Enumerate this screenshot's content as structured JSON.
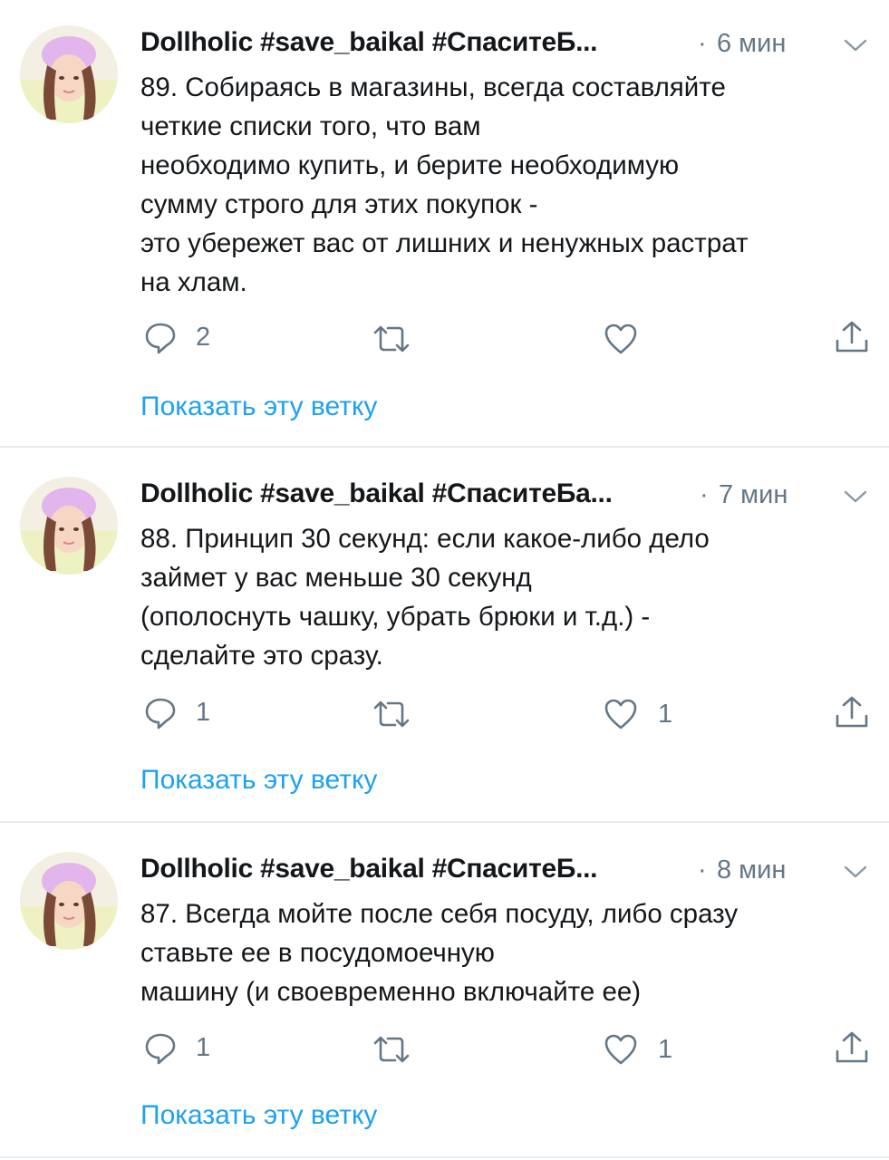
{
  "colors": {
    "link": "#1da1f2",
    "secondary": "#657786",
    "text": "#14171a",
    "divider": "#e6ecf0"
  },
  "tweets": [
    {
      "author": "Dollholic #save_baikal #СпаситеБ...",
      "separator": "·",
      "time": "6 мин",
      "lines": [
        "89. Собираясь в магазины, всегда составляйте",
        "четкие списки того, что вам",
        "необходимо купить, и берите необходимую",
        "сумму строго для этих покупок -",
        "это убережет вас от лишних и ненужных растрат",
        "на хлам."
      ],
      "reply_count": "2",
      "retweet_count": "",
      "like_count": "",
      "thread_link": "Показать эту ветку"
    },
    {
      "author": "Dollholic #save_baikal #СпаситеБа...",
      "separator": "·",
      "time": "7 мин",
      "lines": [
        "88. Принцип 30 секунд: если какое-либо дело",
        "займет у вас меньше 30 секунд",
        "(ополоснуть чашку, убрать брюки и т.д.) -",
        "сделайте это сразу."
      ],
      "reply_count": "1",
      "retweet_count": "",
      "like_count": "1",
      "thread_link": "Показать эту ветку"
    },
    {
      "author": "Dollholic #save_baikal #СпаситеБ...",
      "separator": "·",
      "time": "8 мин",
      "lines": [
        "87. Всегда мойте после себя посуду, либо сразу",
        "ставьте ее в посудомоечную",
        "машину (и своевременно включайте ее)"
      ],
      "reply_count": "1",
      "retweet_count": "",
      "like_count": "1",
      "thread_link": "Показать эту ветку"
    }
  ],
  "icons": {
    "avatar": "user-avatar-photo",
    "reply": "reply-bubble-icon",
    "retweet": "retweet-icon",
    "like": "heart-icon",
    "share": "share-upload-icon",
    "menu": "chevron-down-icon"
  }
}
